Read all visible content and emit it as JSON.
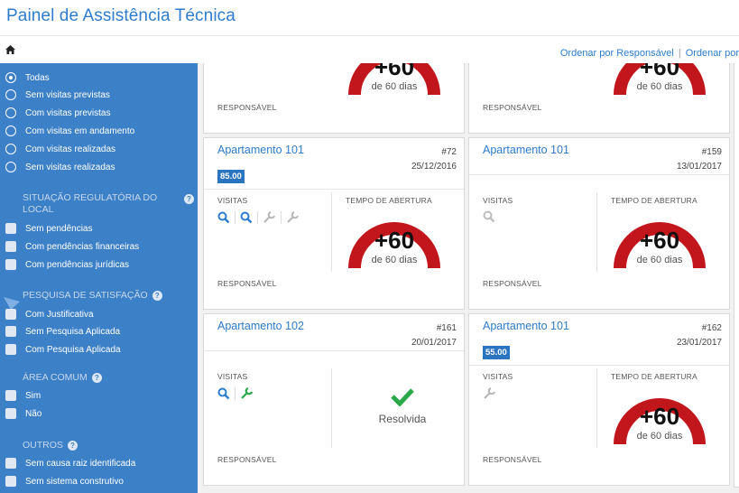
{
  "header": {
    "title": "Painel de Assistência Técnica"
  },
  "toolbar": {
    "sort_by_responsible": "Ordenar por Responsável",
    "sort_by_cut": "Ordenar por"
  },
  "sidebar": {
    "status_options": [
      {
        "label": "Todas",
        "selected": true
      },
      {
        "label": "Sem visitas previstas",
        "selected": false
      },
      {
        "label": "Com visitas previstas",
        "selected": false
      },
      {
        "label": "Com visitas em andamento",
        "selected": false
      },
      {
        "label": "Com visitas realizadas",
        "selected": false
      },
      {
        "label": "Sem visitas realizadas",
        "selected": false
      }
    ],
    "regulatory": {
      "heading": "Situação regulatória do local",
      "options": [
        "Sem pendências",
        "Com pendências financeiras",
        "Com pendências jurídicas"
      ]
    },
    "satisfaction": {
      "heading": "Pesquisa de satisfação",
      "options": [
        "Com Justificativa",
        "Sem Pesquisa Aplicada",
        "Com Pesquisa Aplicada"
      ]
    },
    "common_area": {
      "heading": "Área comum",
      "options": [
        "Sim",
        "Não"
      ]
    },
    "others": {
      "heading": "Outros",
      "options": [
        "Sem causa raiz identificada",
        "Sem sistema construtivo"
      ]
    }
  },
  "labels": {
    "visits": "VISITAS",
    "opening_time": "TEMPO DE ABERTURA",
    "responsible": "RESPONSÁVEL",
    "gauge_value": "+60",
    "gauge_sub": "de 60 dias",
    "resolved": "Resolvida"
  },
  "cards": {
    "top_left": {},
    "top_right": {},
    "c1": {
      "title": "Apartamento 101",
      "number": "#72",
      "date": "25/12/2016",
      "badge": "85.00"
    },
    "c2": {
      "title": "Apartamento 101",
      "number": "#159",
      "date": "13/01/2017"
    },
    "c3": {
      "title": "Apartamento 102",
      "number": "#161",
      "date": "20/01/2017"
    },
    "c4": {
      "title": "Apartamento 101",
      "number": "#162",
      "date": "23/01/2017",
      "badge": "55.00"
    }
  },
  "colors": {
    "primary": "#2d7ccd",
    "sidebar": "#3c80c7",
    "gauge": "#c0161c",
    "success": "#2aa84a"
  }
}
